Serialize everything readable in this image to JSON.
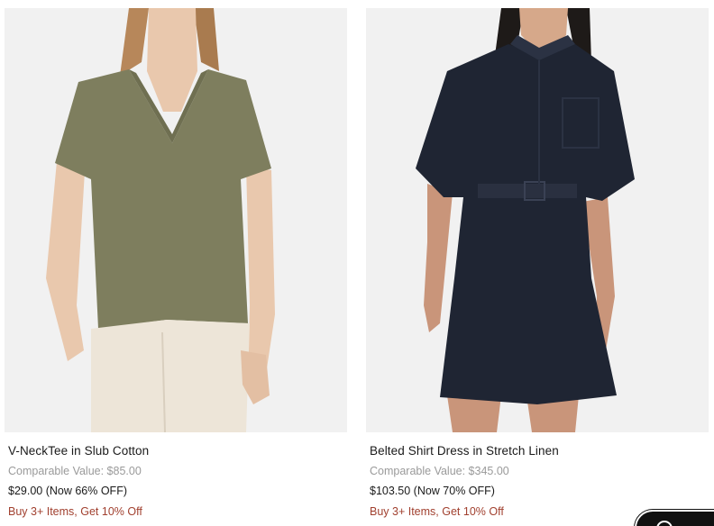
{
  "products": [
    {
      "title": "V-NeckTee in Slub Cotton",
      "comparable": "Comparable Value: $85.00",
      "price_line": "$29.00 (Now 66% OFF)",
      "promo": "Buy 3+ Items, Get 10% Off",
      "image_alt": "Model wearing olive V-neck tee with cream trousers"
    },
    {
      "title": "Belted Shirt Dress in Stretch Linen",
      "comparable": "Comparable Value: $345.00",
      "price_line": "$103.50 (Now 70% OFF)",
      "promo": "Buy 3+ Items, Get 10% Off",
      "image_alt": "Model wearing navy belted shirt dress"
    }
  ],
  "colors": {
    "promo": "#a1402f",
    "muted": "#9a9a9a",
    "text": "#1a1a1a",
    "image_bg": "#f1f1f1"
  },
  "chat": {
    "icon": "chat-icon"
  }
}
